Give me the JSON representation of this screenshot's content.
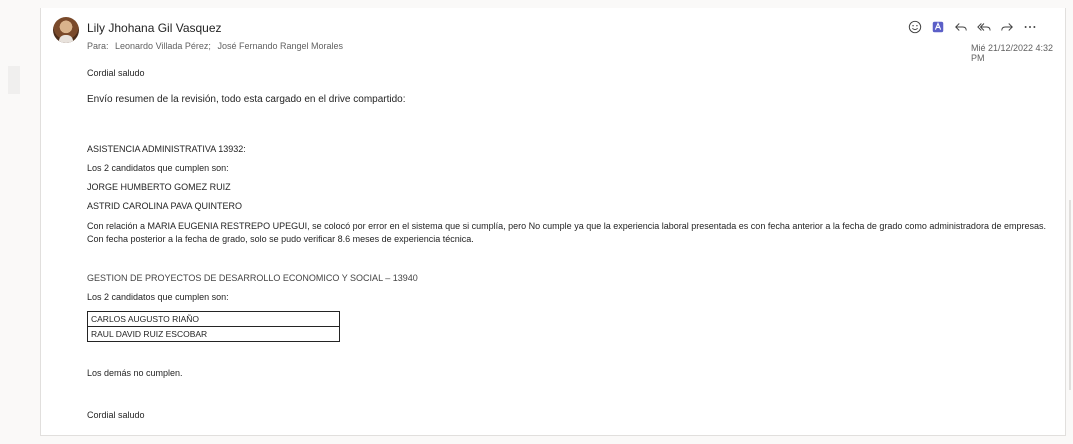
{
  "message": {
    "sender": "Lily Jhohana Gil Vasquez",
    "to_prefix": "Para:",
    "recipients": [
      "Leonardo Villada Pérez;",
      "José Fernando Rangel Morales"
    ],
    "datetime": "Mié 21/12/2022 4:32 PM",
    "actions": [
      {
        "name": "emoji-icon"
      },
      {
        "name": "app-icon"
      },
      {
        "name": "reply-icon"
      },
      {
        "name": "reply-all-icon"
      },
      {
        "name": "forward-icon"
      },
      {
        "name": "more-icon"
      }
    ]
  },
  "body": {
    "greeting": "Cordial saludo",
    "intro": "Envío resumen de la revisión, todo esta cargado en el drive compartido:",
    "section1": {
      "title": "ASISTENCIA ADMINISTRATIVA 13932:",
      "subtitle": "Los 2 candidatos que cumplen son:",
      "candidates": [
        "JORGE HUMBERTO GOMEZ RUIZ",
        "ASTRID CAROLINA PAVA QUINTERO"
      ],
      "note": "Con relación a MARIA EUGENIA RESTREPO UPEGUI, se colocó por error en el sistema que si cumplía, pero No cumple ya que la experiencia laboral presentada es con fecha anterior a la fecha de grado como administradora de empresas. Con fecha posterior a la fecha de grado, solo se pudo verificar 8.6 meses de experiencia técnica."
    },
    "section2": {
      "title": "GESTION DE PROYECTOS DE DESARROLLO ECONOMICO Y SOCIAL – 13940",
      "subtitle": "Los 2 candidatos que cumplen son:",
      "candidates": [
        "CARLOS AUGUSTO RIAÑO",
        "RAUL DAVID RUIZ ESCOBAR"
      ]
    },
    "closing_note": "Los demás no cumplen.",
    "signoff": "Cordial saludo"
  },
  "colors": {
    "accent": "#5b5fc7",
    "text": "#242424",
    "muted": "#616161"
  }
}
